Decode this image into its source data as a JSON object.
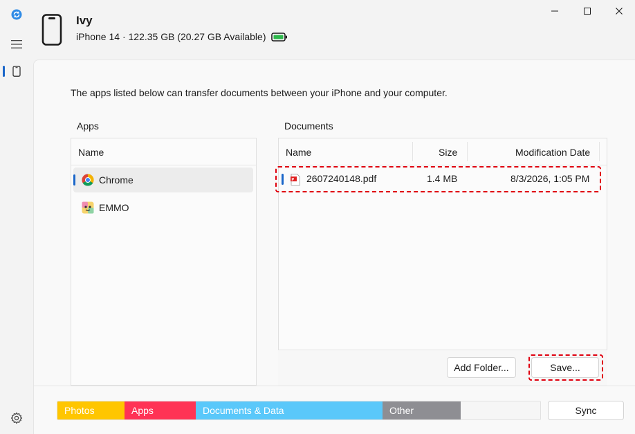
{
  "rail": {
    "icons": [
      "sync-logo-icon",
      "hamburger-menu-icon",
      "phone-icon",
      "settings-gear-icon"
    ]
  },
  "device": {
    "name": "Ivy",
    "info": "iPhone 14 · 122.35 GB (20.27 GB Available)",
    "battery_color": "#2db84b"
  },
  "window": {
    "controls": [
      "minimize",
      "maximize",
      "close"
    ]
  },
  "intro_text": "The apps listed below can transfer documents between your iPhone and your computer.",
  "apps": {
    "section_label": "Apps",
    "column_name": "Name",
    "items": [
      {
        "label": "Chrome",
        "icon": "chrome-icon",
        "selected": true
      },
      {
        "label": "EMMO",
        "icon": "emmo-app-icon",
        "selected": false
      }
    ]
  },
  "documents": {
    "section_label": "Documents",
    "columns": {
      "name": "Name",
      "size": "Size",
      "date": "Modification Date"
    },
    "rows": [
      {
        "name": "2607240148.pdf",
        "size": "1.4 MB",
        "date": "8/3/2026, 1:05 PM",
        "icon": "pdf-file-icon"
      }
    ],
    "add_folder_label": "Add Folder...",
    "save_label": "Save..."
  },
  "storage": {
    "segments": [
      {
        "label": "Photos",
        "color": "#ffc600"
      },
      {
        "label": "Apps",
        "color": "#ff3355"
      },
      {
        "label": "Documents & Data",
        "color": "#5ac8fa"
      },
      {
        "label": "Other",
        "color": "#8e8e93"
      }
    ]
  },
  "sync_label": "Sync",
  "accent_color": "#1a66c9",
  "highlight_color": "#e0000f"
}
